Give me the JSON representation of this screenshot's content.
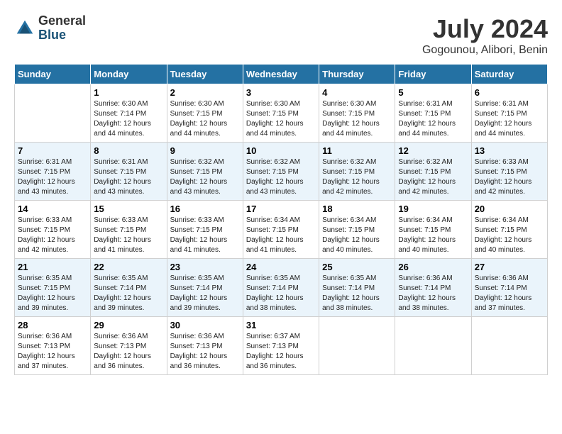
{
  "logo": {
    "general": "General",
    "blue": "Blue"
  },
  "title": {
    "month_year": "July 2024",
    "location": "Gogounou, Alibori, Benin"
  },
  "weekdays": [
    "Sunday",
    "Monday",
    "Tuesday",
    "Wednesday",
    "Thursday",
    "Friday",
    "Saturday"
  ],
  "weeks": [
    [
      {
        "day": "",
        "info": ""
      },
      {
        "day": "1",
        "info": "Sunrise: 6:30 AM\nSunset: 7:14 PM\nDaylight: 12 hours\nand 44 minutes."
      },
      {
        "day": "2",
        "info": "Sunrise: 6:30 AM\nSunset: 7:15 PM\nDaylight: 12 hours\nand 44 minutes."
      },
      {
        "day": "3",
        "info": "Sunrise: 6:30 AM\nSunset: 7:15 PM\nDaylight: 12 hours\nand 44 minutes."
      },
      {
        "day": "4",
        "info": "Sunrise: 6:30 AM\nSunset: 7:15 PM\nDaylight: 12 hours\nand 44 minutes."
      },
      {
        "day": "5",
        "info": "Sunrise: 6:31 AM\nSunset: 7:15 PM\nDaylight: 12 hours\nand 44 minutes."
      },
      {
        "day": "6",
        "info": "Sunrise: 6:31 AM\nSunset: 7:15 PM\nDaylight: 12 hours\nand 44 minutes."
      }
    ],
    [
      {
        "day": "7",
        "info": "Sunrise: 6:31 AM\nSunset: 7:15 PM\nDaylight: 12 hours\nand 43 minutes."
      },
      {
        "day": "8",
        "info": "Sunrise: 6:31 AM\nSunset: 7:15 PM\nDaylight: 12 hours\nand 43 minutes."
      },
      {
        "day": "9",
        "info": "Sunrise: 6:32 AM\nSunset: 7:15 PM\nDaylight: 12 hours\nand 43 minutes."
      },
      {
        "day": "10",
        "info": "Sunrise: 6:32 AM\nSunset: 7:15 PM\nDaylight: 12 hours\nand 43 minutes."
      },
      {
        "day": "11",
        "info": "Sunrise: 6:32 AM\nSunset: 7:15 PM\nDaylight: 12 hours\nand 42 minutes."
      },
      {
        "day": "12",
        "info": "Sunrise: 6:32 AM\nSunset: 7:15 PM\nDaylight: 12 hours\nand 42 minutes."
      },
      {
        "day": "13",
        "info": "Sunrise: 6:33 AM\nSunset: 7:15 PM\nDaylight: 12 hours\nand 42 minutes."
      }
    ],
    [
      {
        "day": "14",
        "info": "Sunrise: 6:33 AM\nSunset: 7:15 PM\nDaylight: 12 hours\nand 42 minutes."
      },
      {
        "day": "15",
        "info": "Sunrise: 6:33 AM\nSunset: 7:15 PM\nDaylight: 12 hours\nand 41 minutes."
      },
      {
        "day": "16",
        "info": "Sunrise: 6:33 AM\nSunset: 7:15 PM\nDaylight: 12 hours\nand 41 minutes."
      },
      {
        "day": "17",
        "info": "Sunrise: 6:34 AM\nSunset: 7:15 PM\nDaylight: 12 hours\nand 41 minutes."
      },
      {
        "day": "18",
        "info": "Sunrise: 6:34 AM\nSunset: 7:15 PM\nDaylight: 12 hours\nand 40 minutes."
      },
      {
        "day": "19",
        "info": "Sunrise: 6:34 AM\nSunset: 7:15 PM\nDaylight: 12 hours\nand 40 minutes."
      },
      {
        "day": "20",
        "info": "Sunrise: 6:34 AM\nSunset: 7:15 PM\nDaylight: 12 hours\nand 40 minutes."
      }
    ],
    [
      {
        "day": "21",
        "info": "Sunrise: 6:35 AM\nSunset: 7:15 PM\nDaylight: 12 hours\nand 39 minutes."
      },
      {
        "day": "22",
        "info": "Sunrise: 6:35 AM\nSunset: 7:14 PM\nDaylight: 12 hours\nand 39 minutes."
      },
      {
        "day": "23",
        "info": "Sunrise: 6:35 AM\nSunset: 7:14 PM\nDaylight: 12 hours\nand 39 minutes."
      },
      {
        "day": "24",
        "info": "Sunrise: 6:35 AM\nSunset: 7:14 PM\nDaylight: 12 hours\nand 38 minutes."
      },
      {
        "day": "25",
        "info": "Sunrise: 6:35 AM\nSunset: 7:14 PM\nDaylight: 12 hours\nand 38 minutes."
      },
      {
        "day": "26",
        "info": "Sunrise: 6:36 AM\nSunset: 7:14 PM\nDaylight: 12 hours\nand 38 minutes."
      },
      {
        "day": "27",
        "info": "Sunrise: 6:36 AM\nSunset: 7:14 PM\nDaylight: 12 hours\nand 37 minutes."
      }
    ],
    [
      {
        "day": "28",
        "info": "Sunrise: 6:36 AM\nSunset: 7:13 PM\nDaylight: 12 hours\nand 37 minutes."
      },
      {
        "day": "29",
        "info": "Sunrise: 6:36 AM\nSunset: 7:13 PM\nDaylight: 12 hours\nand 36 minutes."
      },
      {
        "day": "30",
        "info": "Sunrise: 6:36 AM\nSunset: 7:13 PM\nDaylight: 12 hours\nand 36 minutes."
      },
      {
        "day": "31",
        "info": "Sunrise: 6:37 AM\nSunset: 7:13 PM\nDaylight: 12 hours\nand 36 minutes."
      },
      {
        "day": "",
        "info": ""
      },
      {
        "day": "",
        "info": ""
      },
      {
        "day": "",
        "info": ""
      }
    ]
  ]
}
